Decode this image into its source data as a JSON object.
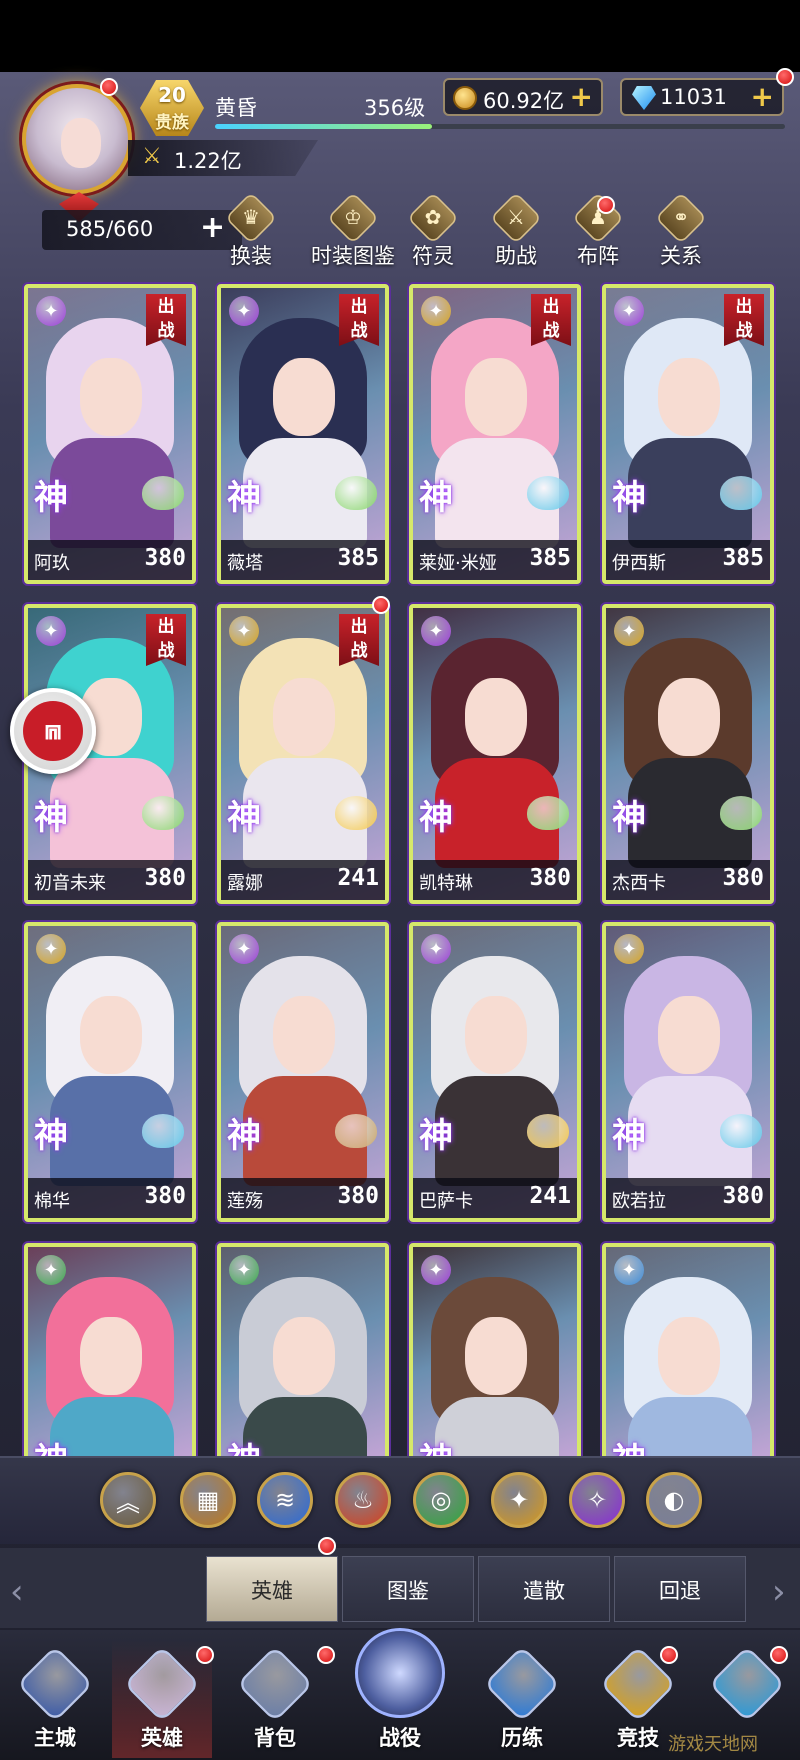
{
  "player": {
    "name": "黄昏",
    "level": "356级",
    "vip_level": "20",
    "vip_label": "贵族",
    "power": "1.22亿",
    "stamina": "585/660",
    "xp_fraction": 0.38
  },
  "currency": {
    "gold": "60.92亿",
    "gems": "11031",
    "plus": "+"
  },
  "features": [
    {
      "label": "换装",
      "icon": "wardrobe-icon",
      "glyph": "♛"
    },
    {
      "label": "时装图鉴",
      "icon": "fashion-catalog-icon",
      "glyph": "♔"
    },
    {
      "label": "符灵",
      "icon": "spirit-icon",
      "glyph": "✿"
    },
    {
      "label": "助战",
      "icon": "assist-icon",
      "glyph": "⚔"
    },
    {
      "label": "布阵",
      "icon": "formation-icon",
      "glyph": "♟"
    },
    {
      "label": "关系",
      "icon": "relation-icon",
      "glyph": "⚭"
    }
  ],
  "deploy_label": [
    "出",
    "战"
  ],
  "god_label": "神",
  "heroes": [
    {
      "name": "阿玖",
      "power": "380",
      "deployed": true,
      "element": "purple",
      "hair": "#e8d4ee",
      "body": "#7b4a9a",
      "pet": "#86d46a"
    },
    {
      "name": "薇塔",
      "power": "385",
      "deployed": true,
      "element": "purple",
      "hair": "#2a2f52",
      "body": "#eceaf2",
      "pet": "#86d46a"
    },
    {
      "name": "莱娅·米娅",
      "power": "385",
      "deployed": true,
      "element": "gold",
      "hair": "#f4a6c6",
      "body": "#f3e4ee",
      "pet": "#5ec6e8"
    },
    {
      "name": "伊西斯",
      "power": "385",
      "deployed": true,
      "element": "purple",
      "hair": "#dfe8f6",
      "body": "#3a3f5c",
      "pet": "#5ec6e8"
    },
    {
      "name": "初音未来",
      "power": "380",
      "deployed": true,
      "element": "purple",
      "hair": "#3fd2cf",
      "body": "#f4c2d8",
      "pet": "#86d46a"
    },
    {
      "name": "露娜",
      "power": "241",
      "deployed": true,
      "element": "gold",
      "hair": "#f3e2b6",
      "body": "#eae6ee",
      "pet": "#f2c64a"
    },
    {
      "name": "凯特琳",
      "power": "380",
      "deployed": false,
      "element": "purple",
      "hair": "#5a2430",
      "body": "#c8222a",
      "pet": "#86d46a"
    },
    {
      "name": "杰西卡",
      "power": "380",
      "deployed": false,
      "element": "gold",
      "hair": "#5b3a2c",
      "body": "#2a2a30",
      "pet": "#86d46a"
    },
    {
      "name": "棉华",
      "power": "380",
      "deployed": false,
      "element": "gold",
      "hair": "#f0eef4",
      "body": "#5870a8",
      "pet": "#5ec6e8"
    },
    {
      "name": "莲殇",
      "power": "380",
      "deployed": false,
      "element": "purple",
      "hair": "#e4e2ea",
      "body": "#b94a3a",
      "pet": "#c9a66a"
    },
    {
      "name": "巴萨卡",
      "power": "241",
      "deployed": false,
      "element": "purple",
      "hair": "#e8e8ec",
      "body": "#3a3236",
      "pet": "#f2c64a"
    },
    {
      "name": "欧若拉",
      "power": "380",
      "deployed": false,
      "element": "gold",
      "hair": "#c9b6e4",
      "body": "#e6dcf2",
      "pet": "#5ec6e8"
    },
    {
      "name": "",
      "power": "",
      "deployed": false,
      "element": "green",
      "hair": "#f2709a",
      "body": "#4fa8c8",
      "pet": ""
    },
    {
      "name": "",
      "power": "",
      "deployed": false,
      "element": "green",
      "hair": "#c9ccd6",
      "body": "#3a4a4a",
      "pet": ""
    },
    {
      "name": "",
      "power": "",
      "deployed": false,
      "element": "purple",
      "hair": "#6b4a3a",
      "body": "#cfd0d8",
      "pet": ""
    },
    {
      "name": "",
      "power": "",
      "deployed": false,
      "element": "blue",
      "hair": "#e2eaf6",
      "body": "#9fb8e0",
      "pet": ""
    }
  ],
  "filters": [
    {
      "name": "collapse-filter-icon",
      "glyph": "︽",
      "color": "#6a5a3a"
    },
    {
      "name": "all-filter-icon",
      "glyph": "▦",
      "color": "#c07a1c"
    },
    {
      "name": "water-filter-icon",
      "glyph": "≋",
      "color": "#2a6ad8"
    },
    {
      "name": "fire-filter-icon",
      "glyph": "♨",
      "color": "#d8401c"
    },
    {
      "name": "wind-filter-icon",
      "glyph": "◎",
      "color": "#2fa83a"
    },
    {
      "name": "light-filter-icon",
      "glyph": "✦",
      "color": "#d89a1c"
    },
    {
      "name": "dark-filter-icon",
      "glyph": "✧",
      "color": "#8a2ad8"
    },
    {
      "name": "mix-filter-icon",
      "glyph": "◐",
      "color": "#7a7f9a"
    }
  ],
  "tabs": [
    "英雄",
    "图鉴",
    "遣散",
    "回退"
  ],
  "nav": [
    {
      "label": "主城",
      "icon": "castle-icon",
      "color": "#3a5aa8"
    },
    {
      "label": "英雄",
      "icon": "hero-icon",
      "color": "#c9b6d8"
    },
    {
      "label": "背包",
      "icon": "bag-icon",
      "color": "#6a7ea8"
    },
    {
      "label": "战役",
      "icon": "battle-icon",
      "color": "#4e5fa0"
    },
    {
      "label": "历练",
      "icon": "trial-icon",
      "color": "#2a7ad8"
    },
    {
      "label": "竞技",
      "icon": "arena-icon",
      "color": "#d8a21c"
    },
    {
      "label": "",
      "icon": "more-icon",
      "color": "#2a9ad8"
    }
  ],
  "watermark": "游戏天地网",
  "colors": {
    "card_border": "#d6e86a",
    "deploy_red": "#c8222a",
    "accent_gold": "#f0c94a"
  }
}
